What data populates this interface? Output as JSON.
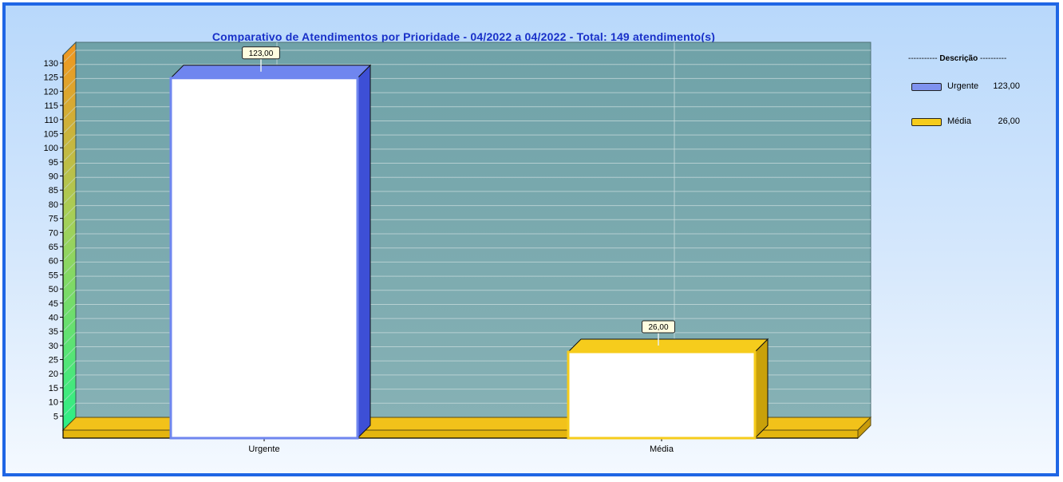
{
  "chart_data": {
    "type": "bar",
    "title": "Comparativo de Atendimentos por Prioridade - 04/2022 a 04/2022 - Total: 149 atendimento(s)",
    "categories": [
      "Urgente",
      "Média"
    ],
    "values": [
      123,
      26
    ],
    "data_labels": [
      "123,00",
      "26,00"
    ],
    "ylim": [
      0,
      130
    ],
    "yticks": [
      5,
      10,
      15,
      20,
      25,
      30,
      35,
      40,
      45,
      50,
      55,
      60,
      65,
      70,
      75,
      80,
      85,
      90,
      95,
      100,
      105,
      110,
      115,
      120,
      125,
      130
    ],
    "grid": true,
    "three_d": true,
    "legend": {
      "position": "right",
      "title": "Descrição",
      "title_left": "-----------",
      "title_right": "----------",
      "items": [
        {
          "label": "Urgente",
          "value": "123,00"
        },
        {
          "label": "Média",
          "value": "26,00"
        }
      ]
    },
    "colors": {
      "bar_fill": "#ffffff",
      "series": [
        "#6f86ef",
        "#f6cc1c"
      ],
      "plot_wall": "#78a5ab",
      "floor": "#f2c21a",
      "title": "#1830c8"
    }
  }
}
